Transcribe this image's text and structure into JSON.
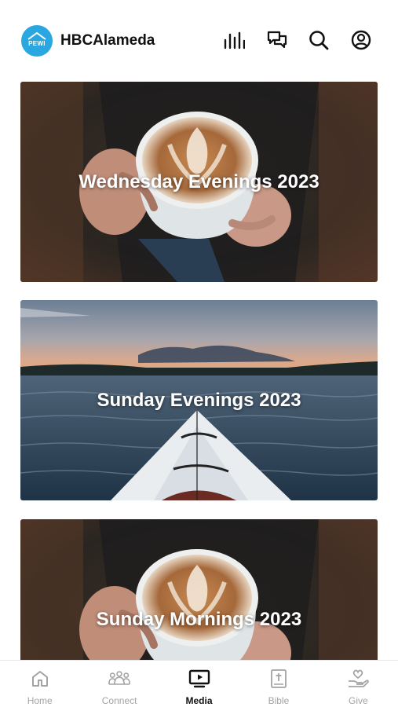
{
  "header": {
    "logo_text": "PEWI",
    "title": "HBCAlameda",
    "icons": [
      "equalizer-icon",
      "chat-icon",
      "search-icon",
      "profile-icon"
    ]
  },
  "cards": [
    {
      "title": "Wednesday Evenings 2023",
      "image": "coffee-cup"
    },
    {
      "title": "Sunday Evenings 2023",
      "image": "kayak-lake-sunset"
    },
    {
      "title": "Sunday Mornings 2023",
      "image": "coffee-cup"
    }
  ],
  "nav": {
    "items": [
      {
        "label": "Home",
        "icon": "home-icon"
      },
      {
        "label": "Connect",
        "icon": "people-icon"
      },
      {
        "label": "Media",
        "icon": "tv-icon",
        "active": true
      },
      {
        "label": "Bible",
        "icon": "bible-icon"
      },
      {
        "label": "Give",
        "icon": "heart-hand-icon"
      }
    ]
  },
  "colors": {
    "brand": "#2aa7e0",
    "active": "#111111",
    "inactive": "#a3a3a3"
  }
}
